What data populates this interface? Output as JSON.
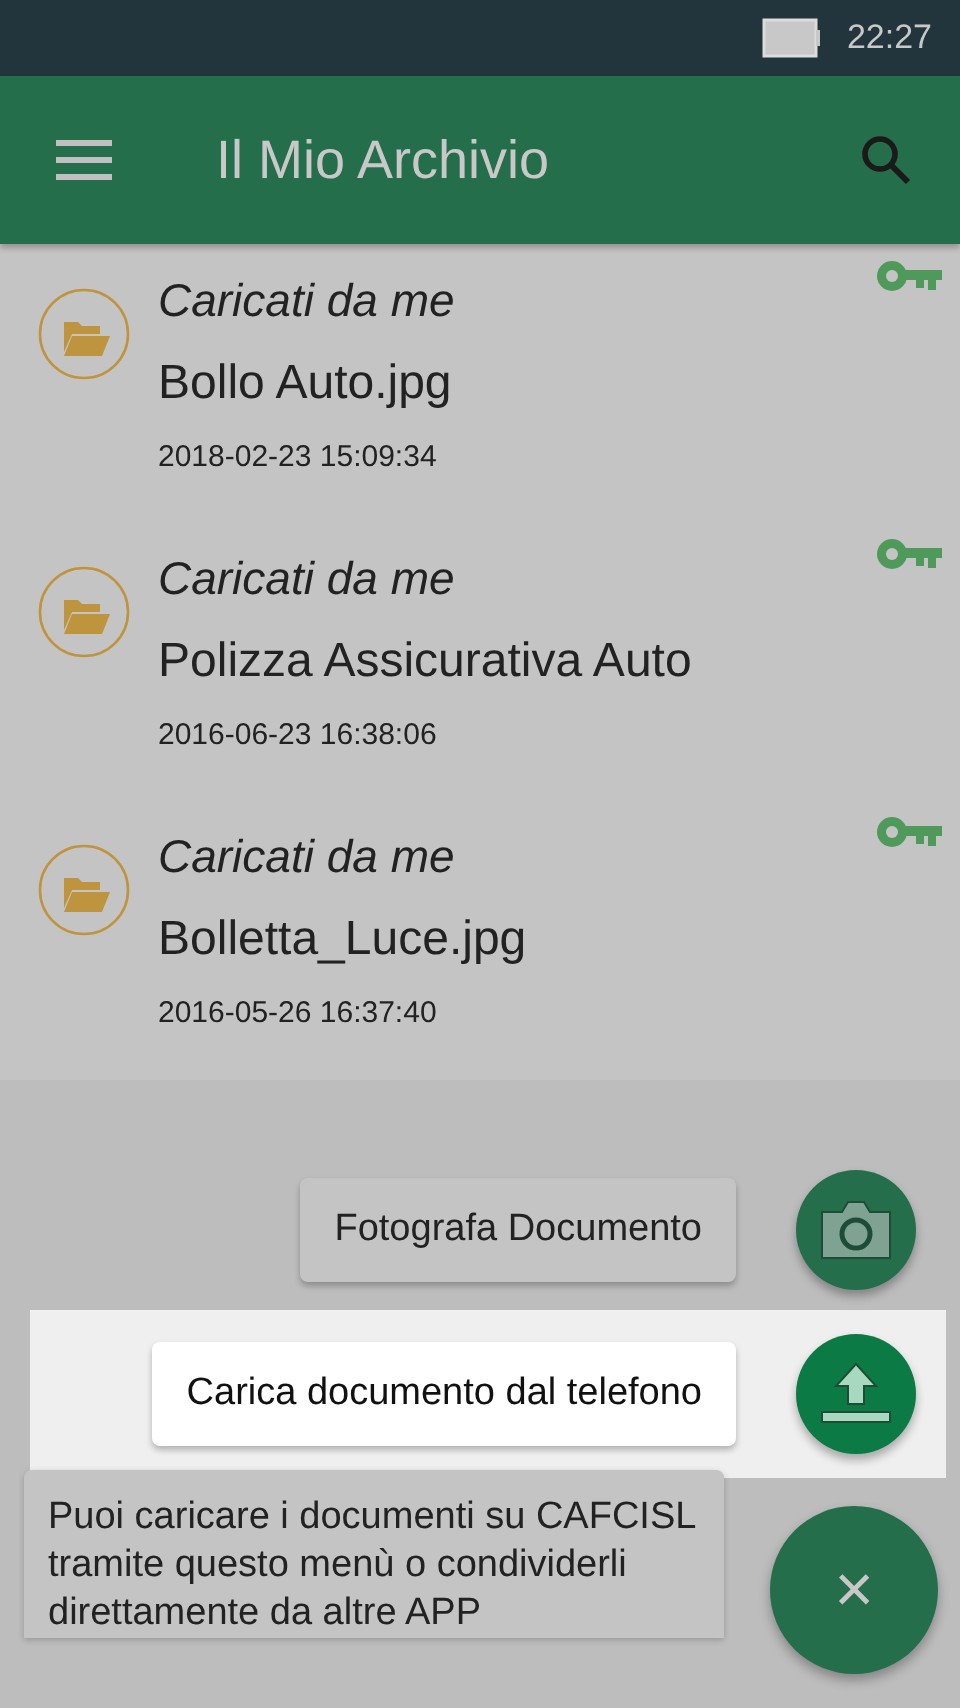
{
  "status_bar": {
    "time": "22:27"
  },
  "app_bar": {
    "title": "Il Mio Archivio"
  },
  "documents": [
    {
      "source": "Caricati da me",
      "name": "Bollo Auto.jpg",
      "date": "2018-02-23 15:09:34"
    },
    {
      "source": "Caricati da me",
      "name": "Polizza Assicurativa Auto",
      "date": "2016-06-23 16:38:06"
    },
    {
      "source": "Caricati da me",
      "name": "Bolletta_Luce.jpg",
      "date": "2016-05-26 16:37:40"
    }
  ],
  "actions": [
    {
      "label": "Fotografa Documento",
      "kind": "camera",
      "highlighted": false
    },
    {
      "label": "Carica documento dal telefono",
      "kind": "upload",
      "highlighted": true
    }
  ],
  "help_tip": {
    "text": "Puoi caricare i documenti su CAFCISL tramite questo menù o condividerli direttamente da altre APP"
  },
  "close_button": {
    "label": "×"
  }
}
